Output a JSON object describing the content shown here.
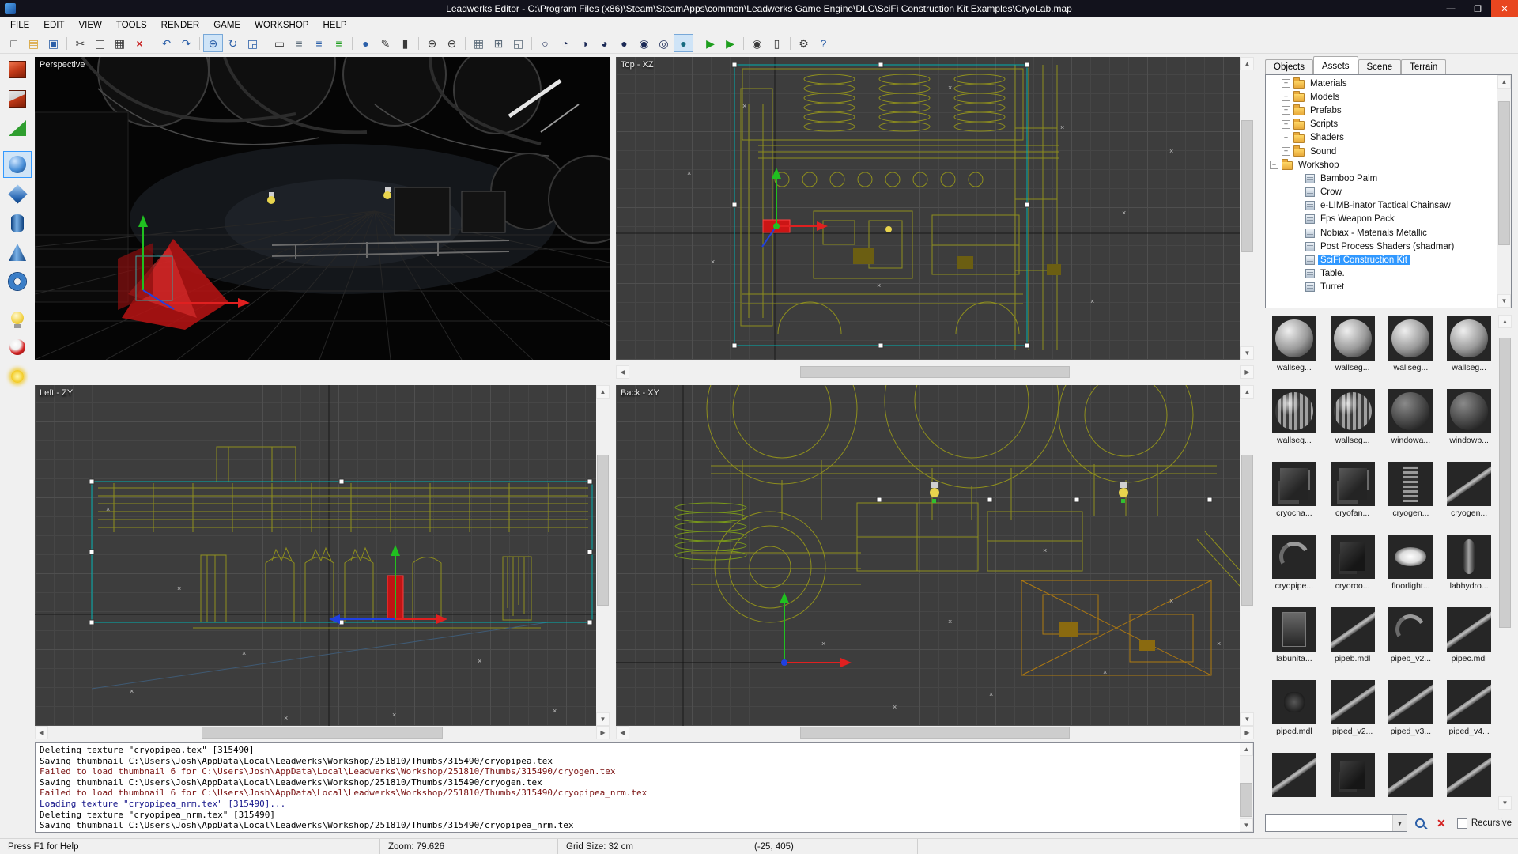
{
  "window": {
    "title": "Leadwerks Editor - C:\\Program Files (x86)\\Steam\\SteamApps\\common\\Leadwerks Game Engine\\DLC\\SciFi Construction Kit Examples\\CryoLab.map",
    "controls": {
      "minimize": "—",
      "maximize": "❐",
      "close": "✕"
    }
  },
  "menu": {
    "items": [
      "FILE",
      "EDIT",
      "VIEW",
      "TOOLS",
      "RENDER",
      "GAME",
      "WORKSHOP",
      "HELP"
    ]
  },
  "toolbar": {
    "buttons": [
      {
        "name": "new-file-button",
        "glyph": "□",
        "gcls": "c-dark"
      },
      {
        "name": "open-folder-button",
        "glyph": "▤",
        "gcls": "c-folder"
      },
      {
        "name": "save-button",
        "glyph": "▣",
        "gcls": "c-blue"
      },
      {
        "name": "toolbar-separator",
        "cls": "sep"
      },
      {
        "name": "cut-button",
        "glyph": "✂",
        "gcls": "c-dark"
      },
      {
        "name": "copy-button",
        "glyph": "◫",
        "gcls": "c-dark"
      },
      {
        "name": "paste-button",
        "glyph": "▦",
        "gcls": "c-dark"
      },
      {
        "name": "delete-button",
        "glyph": "×",
        "gcls": "c-red"
      },
      {
        "name": "toolbar-separator",
        "cls": "sep"
      },
      {
        "name": "undo-button",
        "glyph": "↶",
        "gcls": "c-blue"
      },
      {
        "name": "redo-button",
        "glyph": "↷",
        "gcls": "c-blue"
      },
      {
        "name": "toolbar-separator",
        "cls": "sep"
      },
      {
        "name": "move-tool-button",
        "glyph": "⊕",
        "gcls": "c-blue",
        "selected": true
      },
      {
        "name": "rotate-tool-button",
        "glyph": "↻",
        "gcls": "c-blue"
      },
      {
        "name": "scale-tool-button",
        "glyph": "◲",
        "gcls": "c-blue"
      },
      {
        "name": "toolbar-separator",
        "cls": "sep"
      },
      {
        "name": "select-tool-button",
        "glyph": "▭",
        "gcls": "c-dark"
      },
      {
        "name": "align-left-button",
        "glyph": "≡",
        "gcls": "c-dim"
      },
      {
        "name": "align-center-button",
        "glyph": "≡",
        "gcls": "c-blue"
      },
      {
        "name": "align-right-button",
        "glyph": "≡",
        "gcls": "c-green"
      },
      {
        "name": "toolbar-separator",
        "cls": "sep"
      },
      {
        "name": "paint-tool-button",
        "glyph": "●",
        "gcls": "c-blue"
      },
      {
        "name": "pen-tool-button",
        "glyph": "✎",
        "gcls": "c-dark"
      },
      {
        "name": "lock-button",
        "glyph": "▮",
        "gcls": "c-dark"
      },
      {
        "name": "toolbar-separator",
        "cls": "sep"
      },
      {
        "name": "zoom-in-button",
        "glyph": "⊕",
        "gcls": "c-dark"
      },
      {
        "name": "zoom-out-button",
        "glyph": "⊖",
        "gcls": "c-dark"
      },
      {
        "name": "toolbar-separator",
        "cls": "sep"
      },
      {
        "name": "grid-button",
        "glyph": "▦",
        "gcls": "c-dim"
      },
      {
        "name": "snap-button",
        "glyph": "⊞",
        "gcls": "c-dim"
      },
      {
        "name": "quad-layout-button",
        "glyph": "◱",
        "gcls": "c-dim"
      },
      {
        "name": "toolbar-separator",
        "cls": "sep"
      },
      {
        "name": "wireframe-view-button",
        "glyph": "○",
        "gcls": "c-navy"
      },
      {
        "name": "solid-view-button",
        "glyph": "◔",
        "gcls": "c-navy"
      },
      {
        "name": "shaded-view-button",
        "glyph": "◑",
        "gcls": "c-navy"
      },
      {
        "name": "textured-view-button",
        "glyph": "◕",
        "gcls": "c-navy"
      },
      {
        "name": "lit-view-button",
        "glyph": "●",
        "gcls": "c-navy"
      },
      {
        "name": "perspective-view-button",
        "glyph": "◉",
        "gcls": "c-navy"
      },
      {
        "name": "orbit-view-button",
        "glyph": "◎",
        "gcls": "c-navy"
      },
      {
        "name": "render-mode-button",
        "glyph": "●",
        "gcls": "c-teal",
        "selected": true
      },
      {
        "name": "toolbar-separator",
        "cls": "sep"
      },
      {
        "name": "play-button",
        "glyph": "▶",
        "gcls": "c-green"
      },
      {
        "name": "debug-play-button",
        "glyph": "▶",
        "gcls": "c-green"
      },
      {
        "name": "toolbar-separator",
        "cls": "sep"
      },
      {
        "name": "screenshot-button",
        "glyph": "◉",
        "gcls": "c-dark"
      },
      {
        "name": "publish-button",
        "glyph": "▯",
        "gcls": "c-dark"
      },
      {
        "name": "toolbar-separator",
        "cls": "sep"
      },
      {
        "name": "options-button",
        "glyph": "⚙",
        "gcls": "c-dark"
      },
      {
        "name": "help-button",
        "glyph": "?",
        "gcls": "c-blue"
      }
    ]
  },
  "object_bar": {
    "items": [
      {
        "name": "box-brush-icon",
        "shape": "cube-red"
      },
      {
        "name": "subtract-brush-icon",
        "shape": "cube-red2"
      },
      {
        "name": "wedge-brush-icon",
        "shape": "wedge-green"
      },
      {
        "name": "sphere-brush-icon",
        "shape": "sphere-blue",
        "selected": true,
        "cls": "gap"
      },
      {
        "name": "diamond-brush-icon",
        "shape": "diamond-blue"
      },
      {
        "name": "cylinder-brush-icon",
        "shape": "cylinder-blue"
      },
      {
        "name": "cone-brush-icon",
        "shape": "cone-blue"
      },
      {
        "name": "tube-brush-icon",
        "shape": "torus-blue"
      },
      {
        "name": "light-tool-icon",
        "shape": "bulb-yellow",
        "cls": "gap"
      },
      {
        "name": "material-tool-icon",
        "shape": "ball-red"
      },
      {
        "name": "environment-light-icon",
        "shape": "sun-yellow"
      }
    ]
  },
  "viewports": {
    "perspective": {
      "label": "Perspective"
    },
    "top": {
      "label": "Top - XZ"
    },
    "left": {
      "label": "Left - ZY"
    },
    "back": {
      "label": "Back - XY"
    }
  },
  "right_panel": {
    "tabs": [
      {
        "name": "tab-objects",
        "label": "Objects"
      },
      {
        "name": "tab-assets",
        "label": "Assets",
        "selected": true
      },
      {
        "name": "tab-scene",
        "label": "Scene"
      },
      {
        "name": "tab-terrain",
        "label": "Terrain"
      }
    ],
    "tree": [
      {
        "label": "Materials",
        "toggle": "+",
        "icon": "folder",
        "cls": "d1"
      },
      {
        "label": "Models",
        "toggle": "+",
        "icon": "folder",
        "cls": "d1"
      },
      {
        "label": "Prefabs",
        "toggle": "+",
        "icon": "folder",
        "cls": "d1"
      },
      {
        "label": "Scripts",
        "toggle": "+",
        "icon": "folder",
        "cls": "d1"
      },
      {
        "label": "Shaders",
        "toggle": "+",
        "icon": "folder",
        "cls": "d1"
      },
      {
        "label": "Sound",
        "toggle": "+",
        "icon": "folder",
        "cls": "d1"
      },
      {
        "label": "Workshop",
        "toggle": "−",
        "icon": "folder",
        "cls": "d0"
      },
      {
        "label": "Bamboo Palm",
        "toggle": "",
        "icon": "package",
        "cls": "d2"
      },
      {
        "label": "Crow",
        "toggle": "",
        "icon": "package",
        "cls": "d2"
      },
      {
        "label": "e-LIMB-inator Tactical Chainsaw",
        "toggle": "",
        "icon": "package",
        "cls": "d2"
      },
      {
        "label": "Fps Weapon Pack",
        "toggle": "",
        "icon": "package",
        "cls": "d2"
      },
      {
        "label": "Nobiax - Materials Metallic",
        "toggle": "",
        "icon": "package",
        "cls": "d2"
      },
      {
        "label": "Post Process Shaders (shadmar)",
        "toggle": "",
        "icon": "package",
        "cls": "d2"
      },
      {
        "label": "SciFi Construction Kit",
        "toggle": "",
        "icon": "package",
        "cls": "d2",
        "selected": true
      },
      {
        "label": "Table.",
        "toggle": "",
        "icon": "package",
        "cls": "d2"
      },
      {
        "label": "Turret",
        "toggle": "",
        "icon": "package",
        "cls": "d2"
      }
    ],
    "assets": [
      {
        "label": "wallseg...",
        "thumb": "sphere"
      },
      {
        "label": "wallseg...",
        "thumb": "sphere"
      },
      {
        "label": "wallseg...",
        "thumb": "sphere"
      },
      {
        "label": "wallseg...",
        "thumb": "sphere"
      },
      {
        "label": "wallseg...",
        "thumb": "sphere-ribbed"
      },
      {
        "label": "wallseg...",
        "thumb": "sphere-ribbed"
      },
      {
        "label": "windowa...",
        "thumb": "sphere-dark"
      },
      {
        "label": "windowb...",
        "thumb": "sphere-dark"
      },
      {
        "label": "cryocha...",
        "thumb": "machine"
      },
      {
        "label": "cryofan...",
        "thumb": "machine"
      },
      {
        "label": "cryogen...",
        "thumb": "coil"
      },
      {
        "label": "cryogen...",
        "thumb": "pipe"
      },
      {
        "label": "cryopipe...",
        "thumb": "pipe-curved"
      },
      {
        "label": "cryoroo...",
        "thumb": "machine-dark"
      },
      {
        "label": "floorlight...",
        "thumb": "light"
      },
      {
        "label": "labhydro...",
        "thumb": "cylinder"
      },
      {
        "label": "labunita...",
        "thumb": "cabinet"
      },
      {
        "label": "pipeb.mdl",
        "thumb": "pipe"
      },
      {
        "label": "pipeb_v2...",
        "thumb": "pipe-curved"
      },
      {
        "label": "pipec.mdl",
        "thumb": "pipe"
      },
      {
        "label": "piped.mdl",
        "thumb": "blob"
      },
      {
        "label": "piped_v2...",
        "thumb": "pipe"
      },
      {
        "label": "piped_v3...",
        "thumb": "pipe"
      },
      {
        "label": "piped_v4...",
        "thumb": "pipe"
      },
      {
        "label": "",
        "thumb": "pipe"
      },
      {
        "label": "",
        "thumb": "machine-dark"
      },
      {
        "label": "",
        "thumb": "pipe"
      },
      {
        "label": "",
        "thumb": "pipe"
      }
    ],
    "search": {
      "value": "",
      "combo_arrow": "▼",
      "recursive_label": "Recursive"
    }
  },
  "console": {
    "lines": [
      {
        "text": "Deleting texture \"cryopipea.tex\" [315490]",
        "cls": ""
      },
      {
        "text": "Saving thumbnail C:\\Users\\Josh\\AppData\\Local\\Leadwerks\\Workshop/251810/Thumbs/315490/cryopipea.tex",
        "cls": ""
      },
      {
        "text": "Failed to load thumbnail 6 for C:\\Users\\Josh\\AppData\\Local\\Leadwerks\\Workshop/251810/Thumbs/315490/cryogen.tex",
        "cls": "err"
      },
      {
        "text": "Saving thumbnail C:\\Users\\Josh\\AppData\\Local\\Leadwerks\\Workshop/251810/Thumbs/315490/cryogen.tex",
        "cls": ""
      },
      {
        "text": "Failed to load thumbnail 6 for C:\\Users\\Josh\\AppData\\Local\\Leadwerks\\Workshop/251810/Thumbs/315490/cryopipea_nrm.tex",
        "cls": "err"
      },
      {
        "text": "Loading texture \"cryopipea_nrm.tex\" [315490]...",
        "cls": "info"
      },
      {
        "text": "Deleting texture \"cryopipea_nrm.tex\" [315490]",
        "cls": ""
      },
      {
        "text": "Saving thumbnail C:\\Users\\Josh\\AppData\\Local\\Leadwerks\\Workshop/251810/Thumbs/315490/cryopipea_nrm.tex",
        "cls": ""
      }
    ]
  },
  "statusbar": {
    "help": "Press F1 for Help",
    "zoom": "Zoom: 79.626",
    "grid_size": "Grid Size: 32 cm",
    "coords": "(-25, 405)"
  }
}
